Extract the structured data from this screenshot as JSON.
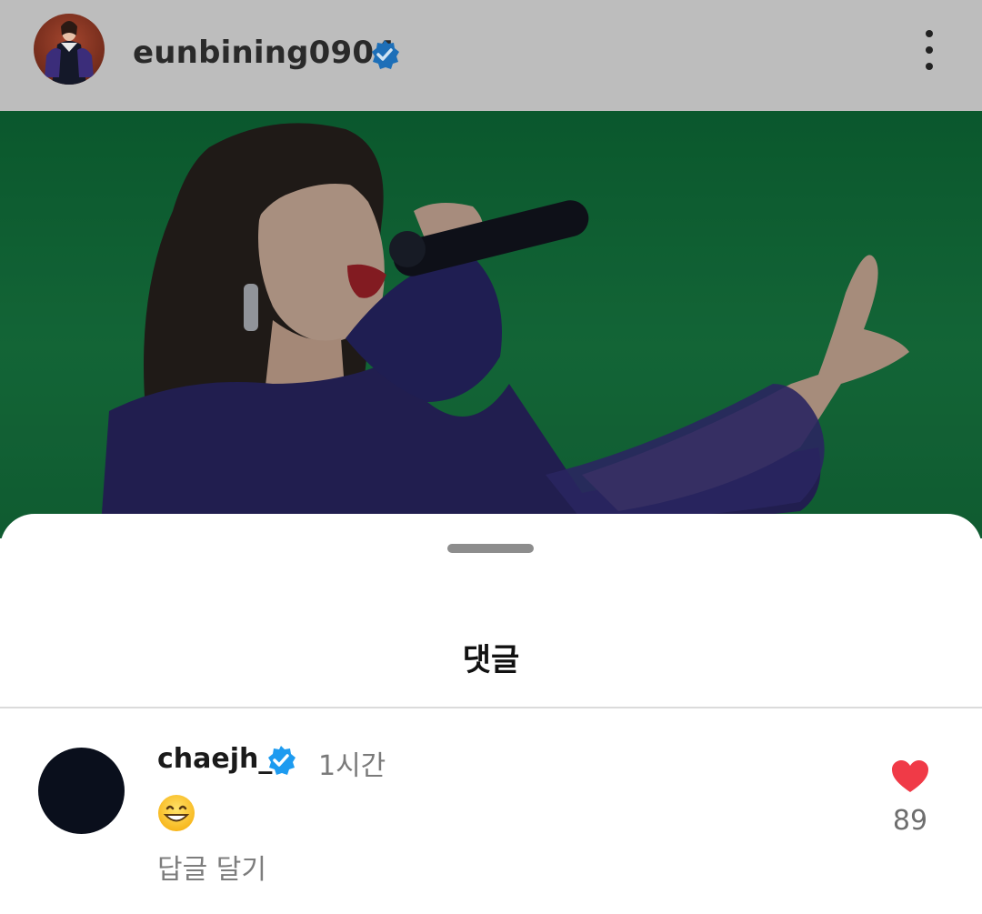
{
  "post": {
    "username": "eunbining0904",
    "verified_icon": "verified-badge-icon",
    "menu_icon": "more-options-icon"
  },
  "comments_sheet": {
    "title": "댓글",
    "comment": {
      "username": "chaejh_",
      "verified_icon": "verified-badge-icon",
      "time": "1시간",
      "emoji": "grinning-face-emoji",
      "reply_label": "답글 달기",
      "like_icon": "heart-icon",
      "like_count": "89",
      "like_color": "#f03a47"
    }
  },
  "colors": {
    "verified": "#1d9bf0",
    "photo_background": "#178646"
  }
}
